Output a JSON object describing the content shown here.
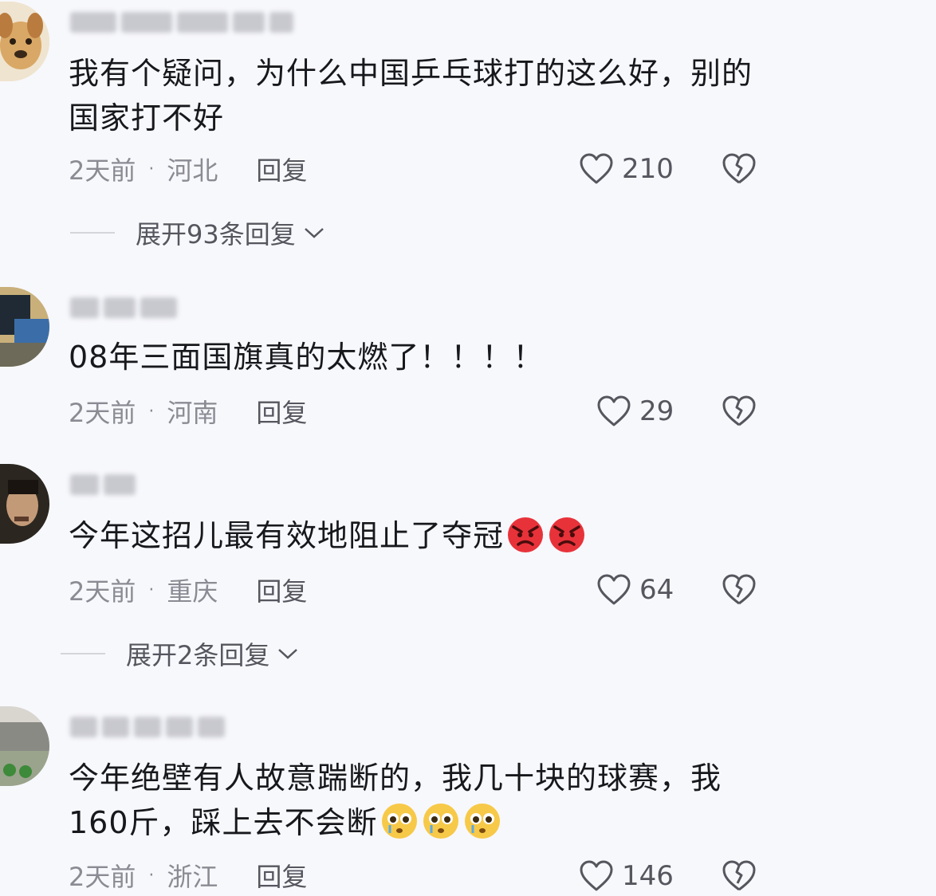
{
  "comments": [
    {
      "text": "我有个疑问，为什么中国乒乓球打的这么好，别的国家打不好",
      "time": "2天前",
      "location": "河北",
      "reply_label": "回复",
      "likes": "210",
      "expand_label": "展开93条回复"
    },
    {
      "text": "08年三面国旗真的太燃了！！！！",
      "time": "2天前",
      "location": "河南",
      "reply_label": "回复",
      "likes": "29"
    },
    {
      "text": "今年这招儿最有效地阻止了夺冠",
      "emojis": [
        "angry-face-icon",
        "angry-face-icon"
      ],
      "time": "2天前",
      "location": "重庆",
      "reply_label": "回复",
      "likes": "64",
      "expand_label": "展开2条回复"
    },
    {
      "text": "今年绝壁有人故意踹断的，我几十块的球赛，我160斤，踩上去不会断",
      "emojis": [
        "pleading-face-icon",
        "pleading-face-icon",
        "pleading-face-icon"
      ],
      "time": "2天前",
      "location": "浙江",
      "reply_label": "回复",
      "likes": "146"
    }
  ],
  "colors": {
    "background": "#f7f8fc",
    "text": "#17181c",
    "meta": "#8a8b93"
  }
}
